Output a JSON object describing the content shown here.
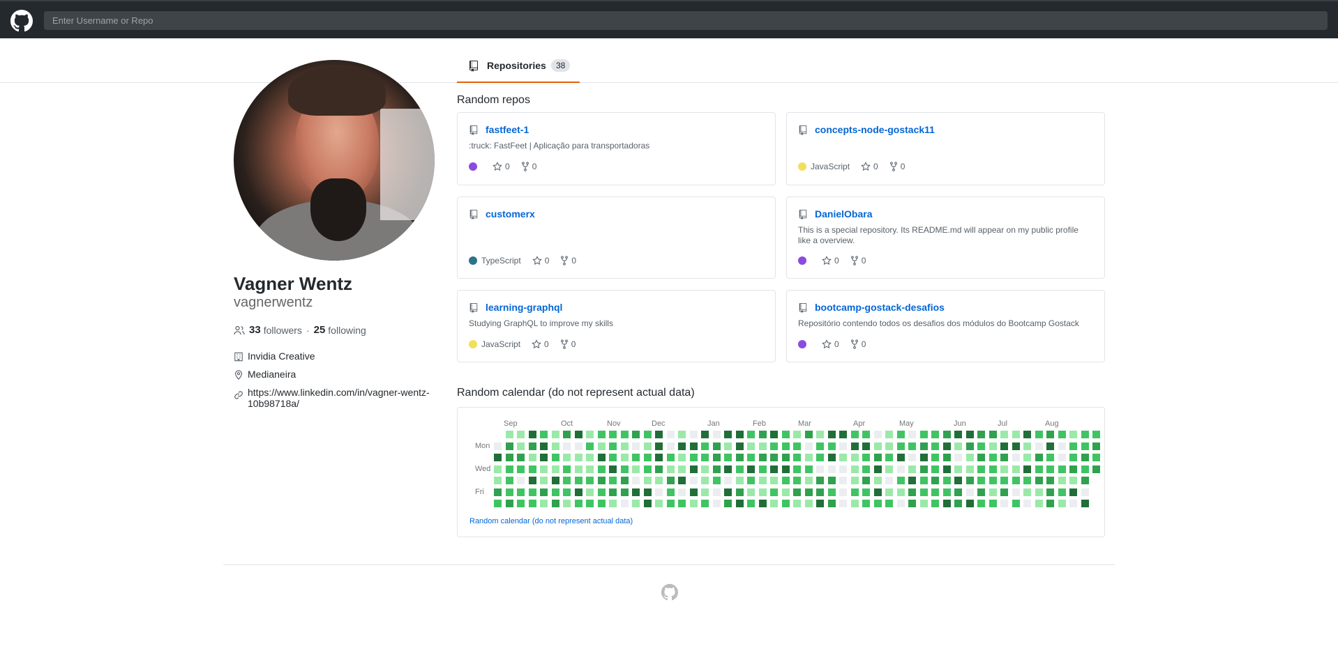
{
  "search": {
    "placeholder": "Enter Username or Repo"
  },
  "tabs": [
    {
      "label": "Repositories",
      "count": "38"
    }
  ],
  "profile": {
    "name": "Vagner Wentz",
    "login": "vagnerwentz",
    "followers": "33",
    "followers_label": "followers",
    "following": "25",
    "following_label": "following",
    "separator": "·",
    "company": "Invidia Creative",
    "location": "Medianeira",
    "website": "https://www.linkedin.com/in/vagner-wentz-10b98718a/"
  },
  "repos_section": {
    "title": "Random repos"
  },
  "repos": [
    {
      "name": "fastfeet-1",
      "description": ":truck: FastFeet | Aplicação para transportadoras",
      "language": "",
      "lang_color": "#8a4be2",
      "stars": "0",
      "forks": "0"
    },
    {
      "name": "concepts-node-gostack11",
      "description": "",
      "language": "JavaScript",
      "lang_color": "#f1e05a",
      "stars": "0",
      "forks": "0"
    },
    {
      "name": "customerx",
      "description": "",
      "language": "TypeScript",
      "lang_color": "#2b7489",
      "stars": "0",
      "forks": "0"
    },
    {
      "name": "DanielObara",
      "description": "This is a special repository. Its README.md will appear on my public profile like a overview.",
      "language": "",
      "lang_color": "#8a4be2",
      "stars": "0",
      "forks": "0"
    },
    {
      "name": "learning-graphql",
      "description": "Studying GraphQL to improve my skills",
      "language": "JavaScript",
      "lang_color": "#f1e05a",
      "stars": "0",
      "forks": "0"
    },
    {
      "name": "bootcamp-gostack-desafios",
      "description": "Repositório contendo todos os desafios dos módulos do Bootcamp Gostack",
      "language": "",
      "lang_color": "#8a4be2",
      "stars": "0",
      "forks": "0"
    }
  ],
  "calendar": {
    "title": "Random calendar (do not represent actual data)",
    "footer_link": "Random calendar (do not represent actual data)",
    "months": [
      "Sep",
      "Oct",
      "Nov",
      "Dec",
      "Jan",
      "Feb",
      "Mar",
      "Apr",
      "May",
      "Jun",
      "Jul",
      "Aug"
    ],
    "day_labels": [
      "Mon",
      "Wed",
      "Fri"
    ],
    "colors": [
      "#ebedf0",
      "#9be9a8",
      "#40c463",
      "#30a14e",
      "#216e39"
    ]
  }
}
